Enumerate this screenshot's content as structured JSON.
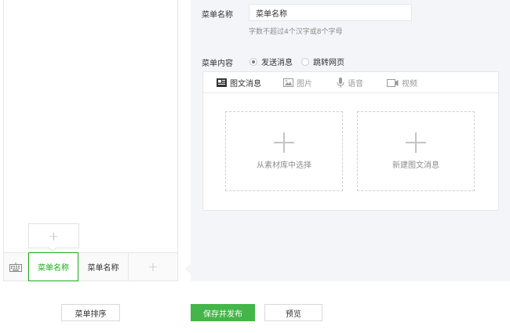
{
  "phone": {
    "menu_items": [
      "菜单名称",
      "菜单名称"
    ],
    "add_symbol": "+",
    "sub_add_symbol": "+"
  },
  "editor": {
    "name_label": "菜单名称",
    "name_value": "菜单名称",
    "name_hint": "字数不超过4个汉字或8个字母",
    "content_label": "菜单内容",
    "radio_options": [
      "发送消息",
      "跳转网页"
    ],
    "selected_option": "发送消息",
    "tabs": [
      {
        "label": "图文消息",
        "icon": "article-icon"
      },
      {
        "label": "图片",
        "icon": "image-icon"
      },
      {
        "label": "语音",
        "icon": "microphone-icon"
      },
      {
        "label": "视频",
        "icon": "video-icon"
      }
    ],
    "active_tab": "图文消息",
    "cards": [
      "从素材库中选择",
      "新建图文消息"
    ]
  },
  "footer": {
    "sort_label": "菜单排序",
    "publish_label": "保存并发布",
    "preview_label": "预览"
  },
  "colors": {
    "accent": "#1aad19",
    "primary_button": "#44b549",
    "panel_bg": "#f4f5f9",
    "border": "#e7e7eb"
  }
}
